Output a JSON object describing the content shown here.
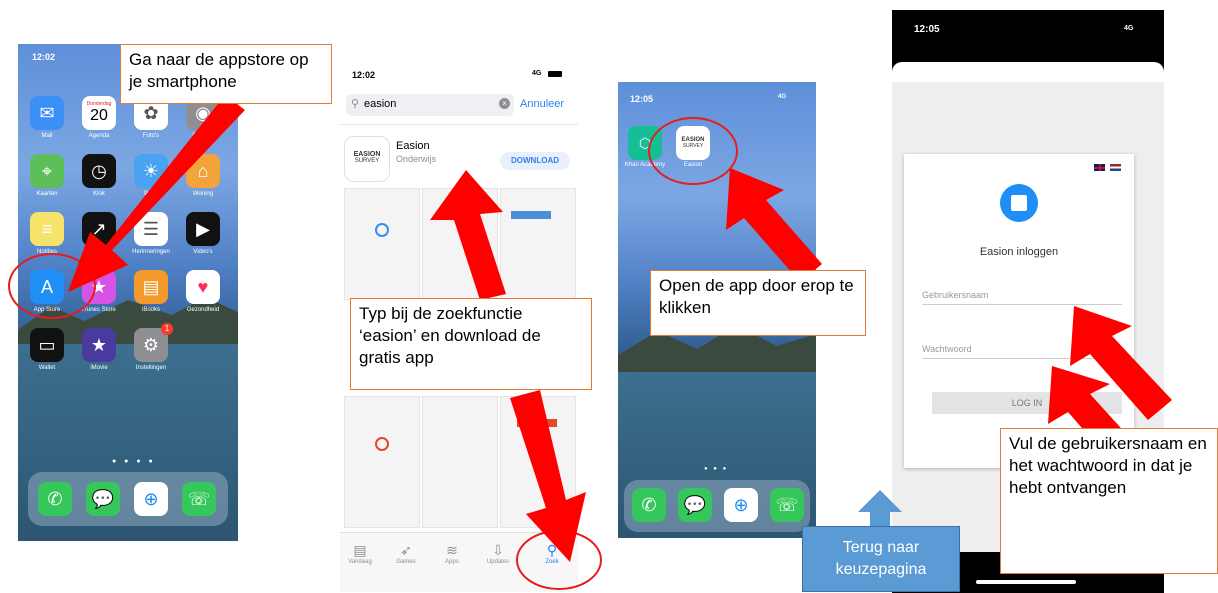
{
  "phone1": {
    "time": "12:02",
    "date_day": "20",
    "date_weekday": "Donderdag",
    "apps": [
      {
        "label": "Mail",
        "icon": "mail-icon",
        "color": "#3b8ff7"
      },
      {
        "label": "Agenda",
        "icon": "calendar-icon",
        "color": "#ffffff"
      },
      {
        "label": "Foto's",
        "icon": "photos-icon",
        "color": "#ffffff"
      },
      {
        "label": "Camera",
        "icon": "camera-icon",
        "color": "#8e8e93"
      },
      {
        "label": "Kaarten",
        "icon": "maps-icon",
        "color": "#5dbf5a"
      },
      {
        "label": "Klok",
        "icon": "clock-icon",
        "color": "#111111"
      },
      {
        "label": "Weer",
        "icon": "weather-icon",
        "color": "#4aa3f0"
      },
      {
        "label": "Woning",
        "icon": "home-icon",
        "color": "#f3a33b"
      },
      {
        "label": "Notities",
        "icon": "notes-icon",
        "color": "#f7e36b"
      },
      {
        "label": "Aandelen",
        "icon": "stocks-icon",
        "color": "#111111"
      },
      {
        "label": "Herinneringen",
        "icon": "reminders-icon",
        "color": "#ffffff"
      },
      {
        "label": "Video's",
        "icon": "videos-icon",
        "color": "#111111"
      },
      {
        "label": "App Store",
        "icon": "app-store-icon",
        "color": "#1f8ef5"
      },
      {
        "label": "iTunes Store",
        "icon": "itunes-star-icon",
        "color": "#d653e6"
      },
      {
        "label": "iBooks",
        "icon": "ibooks-icon",
        "color": "#f39a2a"
      },
      {
        "label": "Gezondheid",
        "icon": "health-heart-icon",
        "color": "#ffffff"
      },
      {
        "label": "Wallet",
        "icon": "wallet-icon",
        "color": "#111111"
      },
      {
        "label": "iMovie",
        "icon": "imovie-star-icon",
        "color": "#4a3a9e"
      },
      {
        "label": "Instellingen",
        "icon": "settings-gear-icon",
        "color": "#8e8e93"
      }
    ],
    "settings_badge": "1",
    "dock": [
      "phone-icon",
      "messages-icon",
      "safari-icon",
      "whatsapp-icon"
    ]
  },
  "phone2": {
    "time": "12:02",
    "signal": "4G",
    "search_value": "easion",
    "cancel_label": "Annuleer",
    "app_name": "Easion",
    "app_category": "Onderwijs",
    "logo_line1": "EASION",
    "logo_line2": "SURVEY",
    "download_label": "DOWNLOAD",
    "tabs": [
      "Vandaag",
      "Games",
      "Apps",
      "Updates",
      "Zoek"
    ]
  },
  "phone3": {
    "time": "12:05",
    "signal": "4G",
    "apps": [
      {
        "label": "Khan Academy",
        "icon": "khan-academy-icon"
      },
      {
        "label": "Easion",
        "icon": "easion-icon"
      }
    ],
    "logo_line1": "EASION",
    "logo_line2": "SURVEY"
  },
  "phone4": {
    "time": "12:05",
    "signal": "4G",
    "login_title": "Easion inloggen",
    "username_placeholder": "Gebruikersnaam",
    "password_placeholder": "Wachtwoord",
    "login_button": "LOG IN"
  },
  "callouts": {
    "step1": "Ga naar de appstore op je smartphone",
    "step2": "Typ bij de zoekfunctie ‘easion’  en download de gratis app",
    "step3": "Open de app door erop te klikken",
    "step4": "Vul de gebruikersnaam en het wachtwoord in dat je hebt ontvangen",
    "back": "Terug naar keuzepagina"
  },
  "colors": {
    "arrow_red": "#ff0000",
    "ring_red": "#e41d1d",
    "callout_border": "#e07b39",
    "back_button": "#5b9bd5"
  }
}
